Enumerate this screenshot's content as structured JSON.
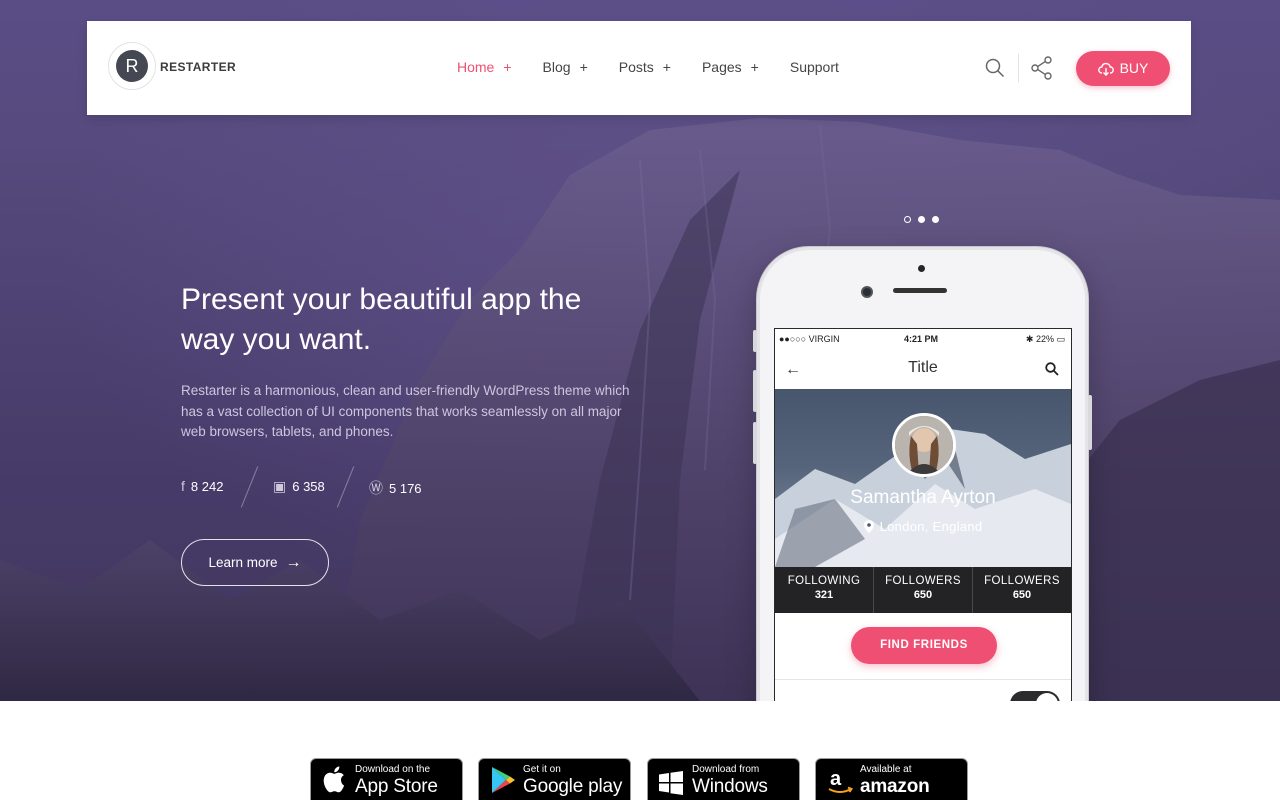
{
  "brand": {
    "logo_letter": "R",
    "name": "RESTARTER"
  },
  "nav": [
    {
      "label": "Home",
      "suffix": "+"
    },
    {
      "label": "Blog",
      "suffix": "+"
    },
    {
      "label": "Posts",
      "suffix": "+"
    },
    {
      "label": "Pages",
      "suffix": "+"
    },
    {
      "label": "Support",
      "suffix": ""
    }
  ],
  "header": {
    "buy_label": "BUY",
    "search_icon": "search-icon",
    "share_icon": "share-icon"
  },
  "hero": {
    "headline": "Present your beautiful app the way you want.",
    "description": "Restarter is a harmonious, clean and user-friendly WordPress theme which has a vast collection of UI components that works seamlessly on all major web browsers, tablets, and phones.",
    "stats": [
      {
        "icon": "facebook-icon",
        "value": "8 242"
      },
      {
        "icon": "youtube-icon",
        "value": "6 358"
      },
      {
        "icon": "wordpress-icon",
        "value": "5 176"
      }
    ],
    "learn_more": "Learn more",
    "slider_dots": 3,
    "active_dot": 1
  },
  "phone": {
    "carrier": "●●○○○ VIRGIN",
    "time": "4:21 PM",
    "battery": "22%",
    "title": "Title",
    "profile_name": "Samantha Ayrton",
    "location": "London, England",
    "stats": [
      {
        "label": "FOLLOWING",
        "value": "321"
      },
      {
        "label": "FOLLOWERS",
        "value": "650"
      },
      {
        "label": "FOLLOWERS",
        "value": "650"
      }
    ],
    "find_friends": "FIND FRIENDS"
  },
  "stores": [
    {
      "small": "Download on the",
      "big": "App Store",
      "icon": "apple-icon"
    },
    {
      "small": "Get it on",
      "big": "Google play",
      "icon": "google-play-icon"
    },
    {
      "small": "Download from",
      "big": "Windows Store",
      "icon": "windows-icon"
    },
    {
      "small": "Available at",
      "big": "amazon",
      "icon": "amazon-icon"
    }
  ],
  "colors": {
    "accent": "#ef4f72",
    "hero_bg": "#4e4273",
    "nav_text": "#454545"
  }
}
